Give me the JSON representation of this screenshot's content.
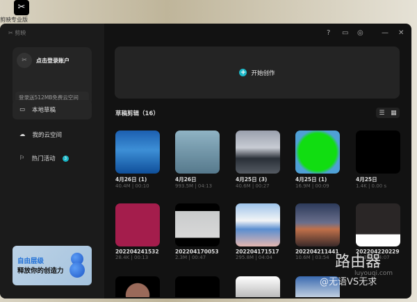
{
  "desktop": {
    "icon_label": "剪映专业版"
  },
  "app": {
    "name": "剪映"
  },
  "account": {
    "title": "点击登录账户",
    "subtitle": "登录送512MB免费云空间"
  },
  "nav": [
    {
      "label": "本地草稿",
      "icon": "folder-icon"
    },
    {
      "label": "我的云空间",
      "icon": "cloud-icon"
    },
    {
      "label": "热门活动",
      "icon": "flag-icon",
      "badge": "3"
    }
  ],
  "banner": {
    "line1": "自由层级",
    "line2": "释放你的创造力"
  },
  "toolbar": {
    "help": "?",
    "feedback": "▭",
    "settings": "◎",
    "minimize": "—",
    "close": "✕"
  },
  "create": {
    "label": "开始创作"
  },
  "drafts": {
    "title": "草稿剪辑（16）",
    "items": [
      {
        "name": "4月26日 (1)",
        "meta": "40.4M | 00:10",
        "bg": "linear-gradient(#1c5fb0,#3d8fd6 45%,#0f4f9a)"
      },
      {
        "name": "4月26日",
        "meta": "993.5M | 04:13",
        "bg": "linear-gradient(#8fb3c4,#56798c)"
      },
      {
        "name": "4月25日 (3)",
        "meta": "40.6M | 00:27",
        "bg": "linear-gradient(#9aa0ad,#c8ccd4 40%,#2a3038 65%,#555b63)"
      },
      {
        "name": "4月25日 (1)",
        "meta": "16.9M | 00:09",
        "bg": "radial-gradient(circle,#11dd11 60%,#4fa0d6 72%)"
      },
      {
        "name": "4月25日",
        "meta": "1.4K | 0.00 s",
        "bg": "#000"
      },
      {
        "name": "202204241532",
        "meta": "28.4K | 00:13",
        "bg": "#a41d4c"
      },
      {
        "name": "202204170053",
        "meta": "2.3M | 00:47",
        "bg": "linear-gradient(#000 18%,#c9cbcc 18%,#d8d8d8 80%,#000 80%)"
      },
      {
        "name": "202204171517",
        "meta": "295.8M | 04:04",
        "bg": "linear-gradient(#9ec4ea,#f2f4f6 40%,#5a8ed0 60%,#e5b7b0)"
      },
      {
        "name": "202204211441",
        "meta": "10.6M | 03:54",
        "bg": "linear-gradient(#2c3a5a,#6a6f8c 45%,#c0704a 60%,#3b2a2a)"
      },
      {
        "name": "202204220229",
        "meta": "26.3M | 04:07",
        "bg": "linear-gradient(#2a2626 72%,#fff 72%)"
      },
      {
        "name": "",
        "meta": "",
        "bg": "radial-gradient(circle at 50% 90%,#9a6a5a 40%,#000 42%)"
      },
      {
        "name": "",
        "meta": "",
        "bg": "#000"
      },
      {
        "name": "",
        "meta": "",
        "bg": "linear-gradient(#fff,#bbb)"
      },
      {
        "name": "",
        "meta": "",
        "bg": "linear-gradient(#3a6ab0,#c0cfe0)"
      }
    ]
  },
  "watermark": {
    "title": "路由器",
    "url": "luyouqi.com",
    "handle": "@无语VS无求"
  }
}
